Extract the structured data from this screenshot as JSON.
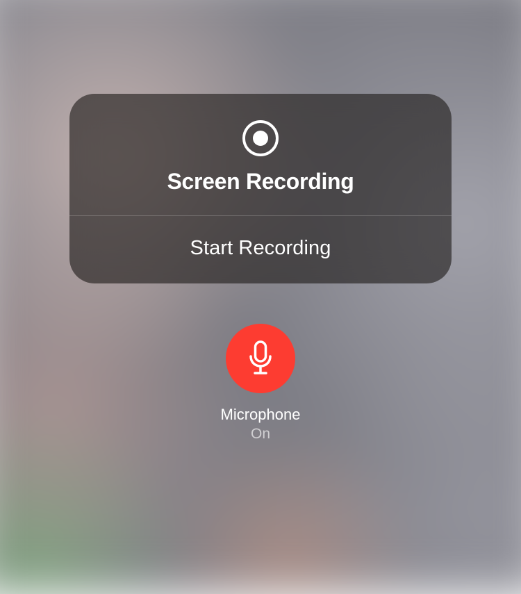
{
  "panel": {
    "title": "Screen Recording",
    "action_label": "Start Recording"
  },
  "microphone": {
    "label": "Microphone",
    "status": "On",
    "active_color": "#fd3c31"
  }
}
